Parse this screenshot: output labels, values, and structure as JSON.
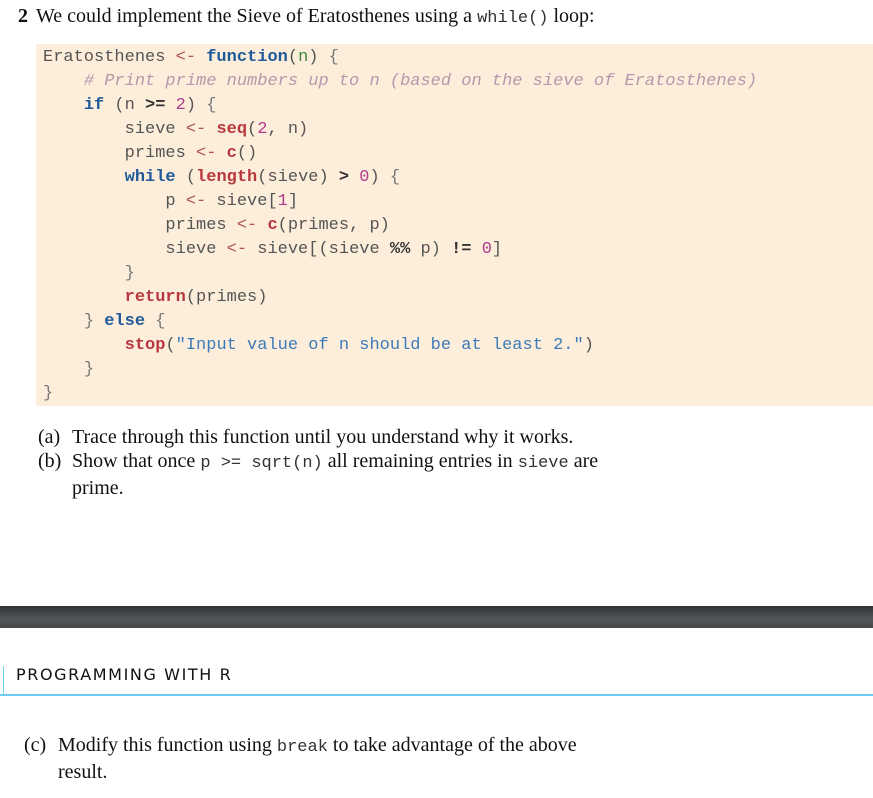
{
  "exercise": {
    "number": "2",
    "intro_before": "We could implement the Sieve of Eratosthenes using a ",
    "intro_code": "while()",
    "intro_after": " loop:"
  },
  "code": {
    "lines": [
      [
        {
          "t": "id",
          "v": "Eratosthenes "
        },
        {
          "t": "op",
          "v": "<-"
        },
        {
          "t": "id",
          "v": " "
        },
        {
          "t": "kw",
          "v": "function"
        },
        {
          "t": "id",
          "v": "("
        },
        {
          "t": "arg",
          "v": "n"
        },
        {
          "t": "id",
          "v": ") "
        },
        {
          "t": "brace",
          "v": "{"
        }
      ],
      [
        {
          "t": "id",
          "v": "    "
        },
        {
          "t": "cmt",
          "v": "# Print prime numbers up to n (based on the sieve of Eratosthenes)"
        }
      ],
      [
        {
          "t": "id",
          "v": "    "
        },
        {
          "t": "kw",
          "v": "if"
        },
        {
          "t": "id",
          "v": " (n "
        },
        {
          "t": "bang",
          "v": ">="
        },
        {
          "t": "id",
          "v": " "
        },
        {
          "t": "num",
          "v": "2"
        },
        {
          "t": "id",
          "v": ") "
        },
        {
          "t": "brace",
          "v": "{"
        }
      ],
      [
        {
          "t": "id",
          "v": "        sieve "
        },
        {
          "t": "op",
          "v": "<-"
        },
        {
          "t": "id",
          "v": " "
        },
        {
          "t": "fn",
          "v": "seq"
        },
        {
          "t": "id",
          "v": "("
        },
        {
          "t": "num",
          "v": "2"
        },
        {
          "t": "id",
          "v": ", n)"
        }
      ],
      [
        {
          "t": "id",
          "v": "        primes "
        },
        {
          "t": "op",
          "v": "<-"
        },
        {
          "t": "id",
          "v": " "
        },
        {
          "t": "fn",
          "v": "c"
        },
        {
          "t": "id",
          "v": "()"
        }
      ],
      [
        {
          "t": "id",
          "v": "        "
        },
        {
          "t": "kw",
          "v": "while"
        },
        {
          "t": "id",
          "v": " ("
        },
        {
          "t": "fn",
          "v": "length"
        },
        {
          "t": "id",
          "v": "(sieve) "
        },
        {
          "t": "bang",
          "v": ">"
        },
        {
          "t": "id",
          "v": " "
        },
        {
          "t": "num",
          "v": "0"
        },
        {
          "t": "id",
          "v": ") "
        },
        {
          "t": "brace",
          "v": "{"
        }
      ],
      [
        {
          "t": "id",
          "v": "            p "
        },
        {
          "t": "op",
          "v": "<-"
        },
        {
          "t": "id",
          "v": " sieve["
        },
        {
          "t": "num",
          "v": "1"
        },
        {
          "t": "id",
          "v": "]"
        }
      ],
      [
        {
          "t": "id",
          "v": "            primes "
        },
        {
          "t": "op",
          "v": "<-"
        },
        {
          "t": "id",
          "v": " "
        },
        {
          "t": "fn",
          "v": "c"
        },
        {
          "t": "id",
          "v": "(primes, p)"
        }
      ],
      [
        {
          "t": "id",
          "v": "            sieve "
        },
        {
          "t": "op",
          "v": "<-"
        },
        {
          "t": "id",
          "v": " sieve[(sieve "
        },
        {
          "t": "bang",
          "v": "%%"
        },
        {
          "t": "id",
          "v": " p) "
        },
        {
          "t": "bang",
          "v": "!="
        },
        {
          "t": "id",
          "v": " "
        },
        {
          "t": "num",
          "v": "0"
        },
        {
          "t": "id",
          "v": "]"
        }
      ],
      [
        {
          "t": "id",
          "v": "        "
        },
        {
          "t": "brace",
          "v": "}"
        }
      ],
      [
        {
          "t": "id",
          "v": "        "
        },
        {
          "t": "fn",
          "v": "return"
        },
        {
          "t": "id",
          "v": "(primes)"
        }
      ],
      [
        {
          "t": "id",
          "v": "    "
        },
        {
          "t": "brace",
          "v": "}"
        },
        {
          "t": "id",
          "v": " "
        },
        {
          "t": "kw",
          "v": "else"
        },
        {
          "t": "id",
          "v": " "
        },
        {
          "t": "brace",
          "v": "{"
        }
      ],
      [
        {
          "t": "id",
          "v": "        "
        },
        {
          "t": "fn",
          "v": "stop"
        },
        {
          "t": "id",
          "v": "("
        },
        {
          "t": "str",
          "v": "\"Input value of n should be at least 2.\""
        },
        {
          "t": "id",
          "v": ")"
        }
      ],
      [
        {
          "t": "id",
          "v": "    "
        },
        {
          "t": "brace",
          "v": "}"
        }
      ],
      [
        {
          "t": "brace",
          "v": "}"
        }
      ]
    ]
  },
  "parts": {
    "a": {
      "label": "(a)",
      "text": "Trace through this function until you understand why it works."
    },
    "b": {
      "label": "(b)",
      "before": "Show that once ",
      "code1": "p >= sqrt(n)",
      "middle": " all remaining entries in ",
      "code2": "sieve",
      "after": " are prime."
    },
    "c": {
      "label": "(c)",
      "before": "Modify this function using ",
      "code": "break",
      "after": " to take advantage of the above result."
    }
  },
  "running_head": {
    "title": "PROGRAMMING WITH R"
  },
  "colors": {
    "code_background": "#fdeedb",
    "keyword": "#1f5a99",
    "function": "#b8383f",
    "number": "#b03a8a",
    "comment": "#b598aa",
    "string": "#3d7ab8",
    "rule_accent": "#6fcdf0"
  }
}
